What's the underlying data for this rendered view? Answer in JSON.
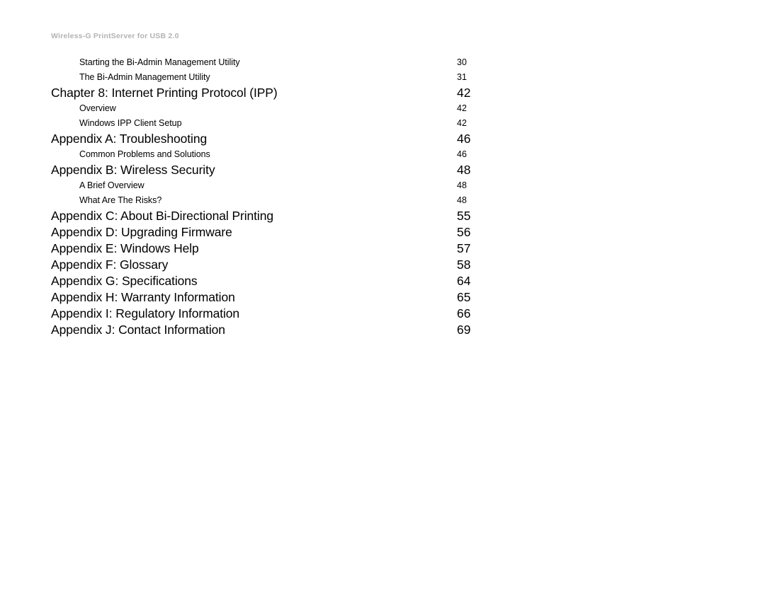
{
  "header": {
    "running_title": "Wireless-G PrintServer for USB 2.0",
    "color": "#b3b3b3"
  },
  "toc": {
    "entries": [
      {
        "level": 2,
        "title": "Starting the Bi-Admin Management Utility",
        "page": "30"
      },
      {
        "level": 2,
        "title": "The Bi-Admin Management Utility",
        "page": "31"
      },
      {
        "level": 1,
        "title": "Chapter 8: Internet Printing Protocol (IPP)",
        "page": "42"
      },
      {
        "level": 2,
        "title": "Overview",
        "page": "42"
      },
      {
        "level": 2,
        "title": "Windows IPP Client Setup",
        "page": "42"
      },
      {
        "level": 1,
        "title": "Appendix A: Troubleshooting",
        "page": "46"
      },
      {
        "level": 2,
        "title": "Common Problems and Solutions",
        "page": "46"
      },
      {
        "level": 1,
        "title": "Appendix B: Wireless Security",
        "page": "48"
      },
      {
        "level": 2,
        "title": "A Brief Overview",
        "page": "48"
      },
      {
        "level": 2,
        "title": "What Are The Risks?",
        "page": "48"
      },
      {
        "level": 1,
        "title": "Appendix C: About Bi-Directional Printing",
        "page": "55"
      },
      {
        "level": 1,
        "title": "Appendix D: Upgrading Firmware",
        "page": "56"
      },
      {
        "level": 1,
        "title": "Appendix E: Windows Help",
        "page": "57"
      },
      {
        "level": 1,
        "title": "Appendix F: Glossary",
        "page": "58"
      },
      {
        "level": 1,
        "title": "Appendix G: Specifications",
        "page": "64"
      },
      {
        "level": 1,
        "title": "Appendix H: Warranty Information",
        "page": "65"
      },
      {
        "level": 1,
        "title": "Appendix I: Regulatory Information",
        "page": "66"
      },
      {
        "level": 1,
        "title": "Appendix J: Contact Information",
        "page": "69"
      }
    ]
  }
}
